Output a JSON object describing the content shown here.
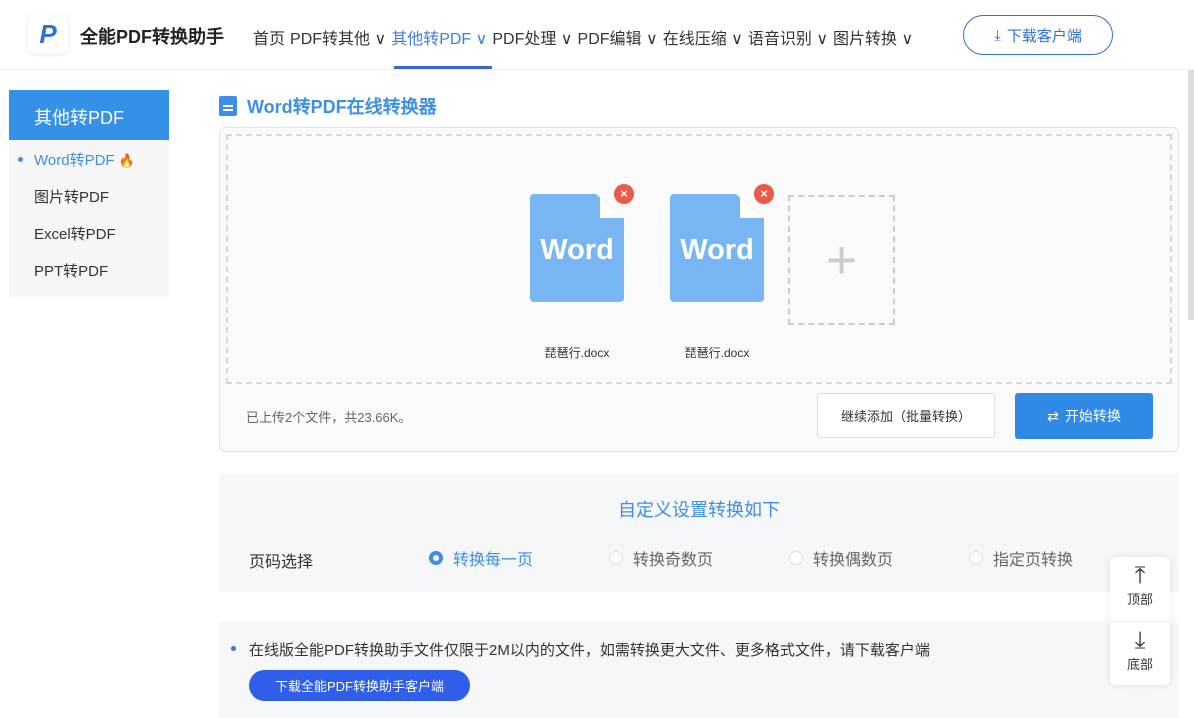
{
  "header": {
    "brand": "全能PDF转换助手",
    "nav": [
      "首页",
      "PDF转其他 ∨",
      "其他转PDF ∨",
      "PDF处理 ∨",
      "PDF编辑 ∨",
      "在线压缩 ∨",
      "语音识别 ∨",
      "图片转换 ∨"
    ],
    "active_nav": 2,
    "download": "下载客户端"
  },
  "sidebar": {
    "title": "其他转PDF",
    "items": [
      "Word转PDF",
      "图片转PDF",
      "Excel转PDF",
      "PPT转PDF"
    ],
    "active": 0,
    "hot_icon": "fire-icon"
  },
  "main": {
    "title": "Word转PDF在线转换器",
    "files": [
      {
        "name": "琵琶行.docx",
        "type_label": "Word"
      },
      {
        "name": "琵琶行.docx",
        "type_label": "Word"
      }
    ],
    "info": "已上传2个文件，共23.66K。",
    "continue_label": "继续添加（批量转换）",
    "start_label": "开始转换"
  },
  "options": {
    "title": "自定义设置转换如下",
    "label": "页码选择",
    "radios": [
      "转换每一页",
      "转换奇数页",
      "转换偶数页",
      "指定页转换"
    ],
    "selected": 0
  },
  "note": {
    "text": "在线版全能PDF转换助手文件仅限于2M以内的文件，如需转换更大文件、更多格式文件，请下载客户端",
    "button": "下载全能PDF转换助手客户端"
  },
  "float": {
    "top": "顶部",
    "bottom": "底部"
  },
  "colors": {
    "accent": "#3d8ee8",
    "brand_blue": "#2f5ee8",
    "file_blue": "#77b6f2",
    "delete_red": "#e85a4a"
  }
}
